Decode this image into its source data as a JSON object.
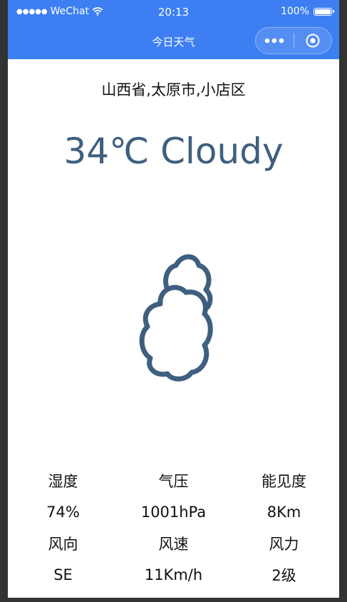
{
  "status_bar": {
    "signal": "●●●●●",
    "carrier": "WeChat",
    "time": "20:13",
    "battery_text": "100%",
    "battery_level": 1.0
  },
  "nav": {
    "title": "今日天气",
    "more_glyph": "•••",
    "colors": {
      "background": "#3d7ff2"
    }
  },
  "weather": {
    "location": "山西省,太原市,小店区",
    "temp_line": "34℃ Cloudy",
    "icon": "cloudy-icon",
    "accent_color": "#3e5f80"
  },
  "details": [
    {
      "label": "湿度",
      "value": "74%"
    },
    {
      "label": "气压",
      "value": "1001hPa"
    },
    {
      "label": "能见度",
      "value": "8Km"
    },
    {
      "label": "风向",
      "value": "SE"
    },
    {
      "label": "风速",
      "value": "11Km/h"
    },
    {
      "label": "风力",
      "value": "2级"
    }
  ]
}
